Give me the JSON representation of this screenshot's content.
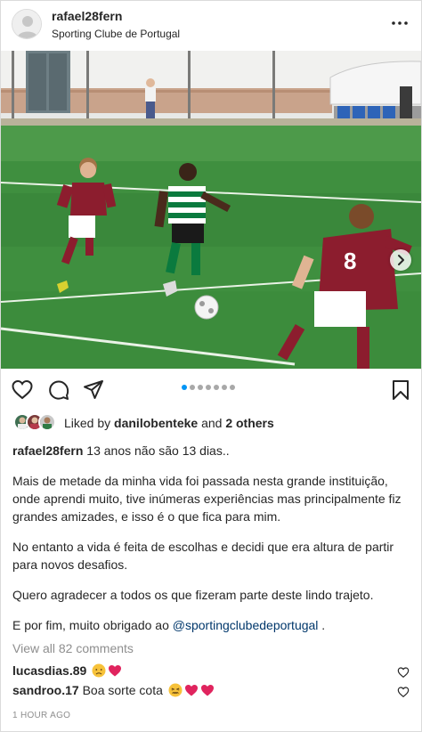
{
  "header": {
    "username": "rafael28fern",
    "location": "Sporting Clube de Portugal"
  },
  "carousel": {
    "slide_count": 7,
    "active_index": 0
  },
  "likes": {
    "prefix": "Liked by ",
    "user": "danilobenteke",
    "middle": " and ",
    "others": "2 others"
  },
  "caption": {
    "username": "rafael28fern",
    "first_line": " 13 anos não são 13 dias..",
    "paragraph_1": "Mais de metade da minha vida foi passada nesta grande instituição, onde aprendi muito, tive inúmeras experiências mas principalmente fiz grandes amizades, e isso é o que fica para mim.",
    "paragraph_2": "No entanto a vida é feita de escolhas e decidi que era altura de partir para novos desafios.",
    "paragraph_3": "Quero agradecer a todos os que fizeram parte deste lindo trajeto.",
    "paragraph_4_prefix": "E por fim, muito obrigado ao ",
    "mention": "@sportingclubedeportugal",
    "paragraph_4_suffix": " ."
  },
  "view_comments": "View all 82 comments",
  "comments": [
    {
      "username": "lucasdias.89",
      "text": "",
      "emojis": [
        "disappointed-face",
        "red-heart"
      ]
    },
    {
      "username": "sandroo.17",
      "text": " Boa sorte cota ",
      "emojis": [
        "confounded-face",
        "red-heart",
        "red-heart"
      ]
    }
  ],
  "timestamp": "1 HOUR AGO",
  "colors": {
    "link": "#00376b",
    "active_dot": "#0095f6",
    "muted": "#8e8e8e",
    "heart": "#e0245e",
    "sporting_green": "#0a7a3e",
    "opponent_red": "#8c1d2e"
  }
}
